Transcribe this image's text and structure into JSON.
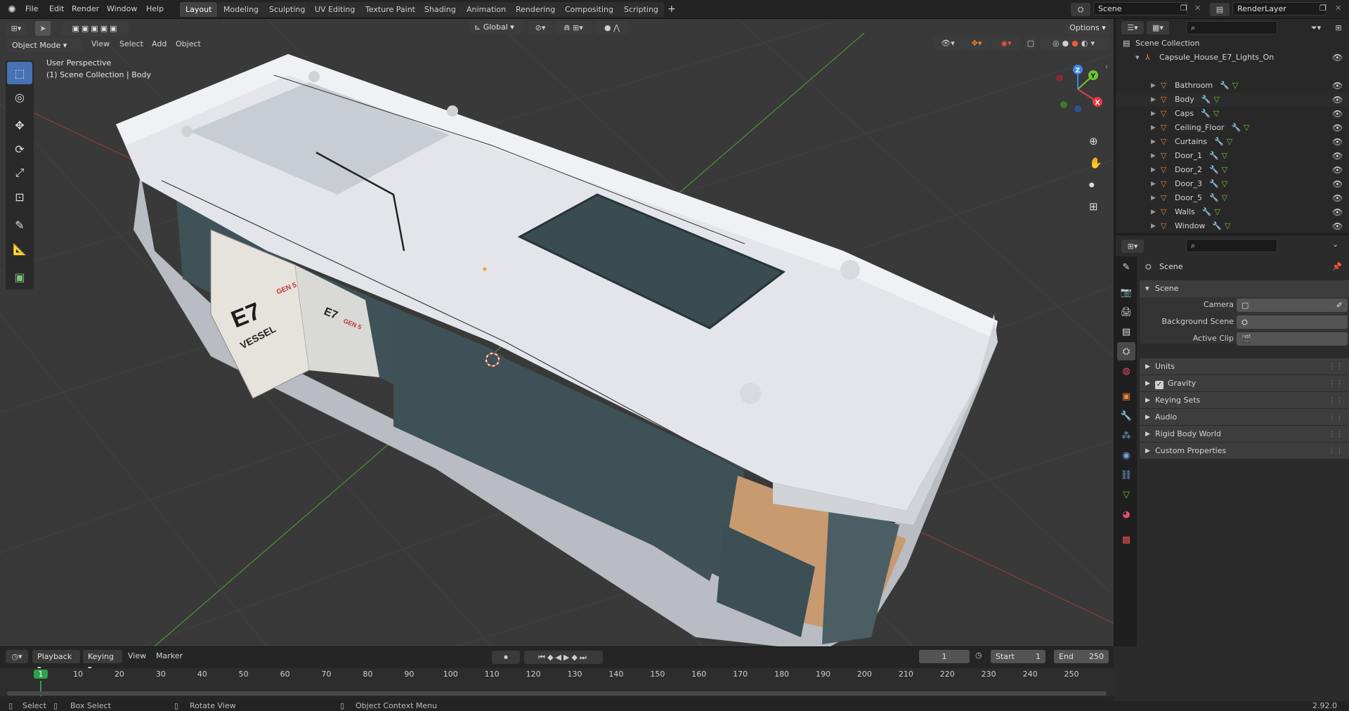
{
  "topbar": {
    "menus": [
      "File",
      "Edit",
      "Render",
      "Window",
      "Help"
    ],
    "workspaces": [
      "Layout",
      "Modeling",
      "Sculpting",
      "UV Editing",
      "Texture Paint",
      "Shading",
      "Animation",
      "Rendering",
      "Compositing",
      "Scripting"
    ],
    "active_workspace": "Layout",
    "add_tab": "+",
    "scene": "Scene",
    "view_layer": "RenderLayer"
  },
  "viewport_header": {
    "mode": "Object Mode",
    "menus": [
      "View",
      "Select",
      "Add",
      "Object"
    ],
    "orientation": "Global",
    "options": "Options"
  },
  "viewport": {
    "perspective": "User Perspective",
    "collection_info": "(1) Scene Collection | Body",
    "axis_labels": {
      "x": "X",
      "y": "Y",
      "z": "Z"
    },
    "door_text": "VESSEL",
    "door_logo": "E7",
    "door_gen": "GEN 5",
    "wall_logo": "E7",
    "wall_gen": "GEN 5"
  },
  "outliner": {
    "root": "Scene Collection",
    "collection": "Capsule_House_E7_Lights_On",
    "objects": [
      "Bathroom",
      "Body",
      "Caps",
      "Ceiling_Floor",
      "Curtains",
      "Door_1",
      "Door_2",
      "Door_3",
      "Door_5",
      "Walls",
      "Window"
    ]
  },
  "properties": {
    "context": "Scene",
    "panel_title": "Scene",
    "fields": [
      {
        "label": "Camera",
        "value": ""
      },
      {
        "label": "Background Scene",
        "value": ""
      },
      {
        "label": "Active Clip",
        "value": ""
      }
    ],
    "subpanels": [
      "Units",
      "Gravity",
      "Keying Sets",
      "Audio",
      "Rigid Body World",
      "Custom Properties"
    ],
    "gravity_checked": true
  },
  "timeline": {
    "menus": [
      "Playback",
      "Keying",
      "View",
      "Marker"
    ],
    "current_frame": "1",
    "start_label": "Start",
    "start": "1",
    "end_label": "End",
    "end": "250",
    "ruler": [
      "1",
      "10",
      "20",
      "30",
      "40",
      "50",
      "60",
      "70",
      "80",
      "90",
      "100",
      "110",
      "120",
      "130",
      "140",
      "150",
      "160",
      "170",
      "180",
      "190",
      "200",
      "210",
      "220",
      "230",
      "240",
      "250"
    ]
  },
  "status": {
    "select": "Select",
    "box_select": "Box Select",
    "rotate": "Rotate View",
    "context_menu": "Object Context Menu",
    "version": "2.92.0"
  },
  "colors": {
    "accent": "#4772b3",
    "object_orange": "#e8873a",
    "active_frame": "#2ea14a",
    "x_axis": "#e83a45",
    "y_axis": "#6ec52f",
    "z_axis": "#3f84e5"
  }
}
